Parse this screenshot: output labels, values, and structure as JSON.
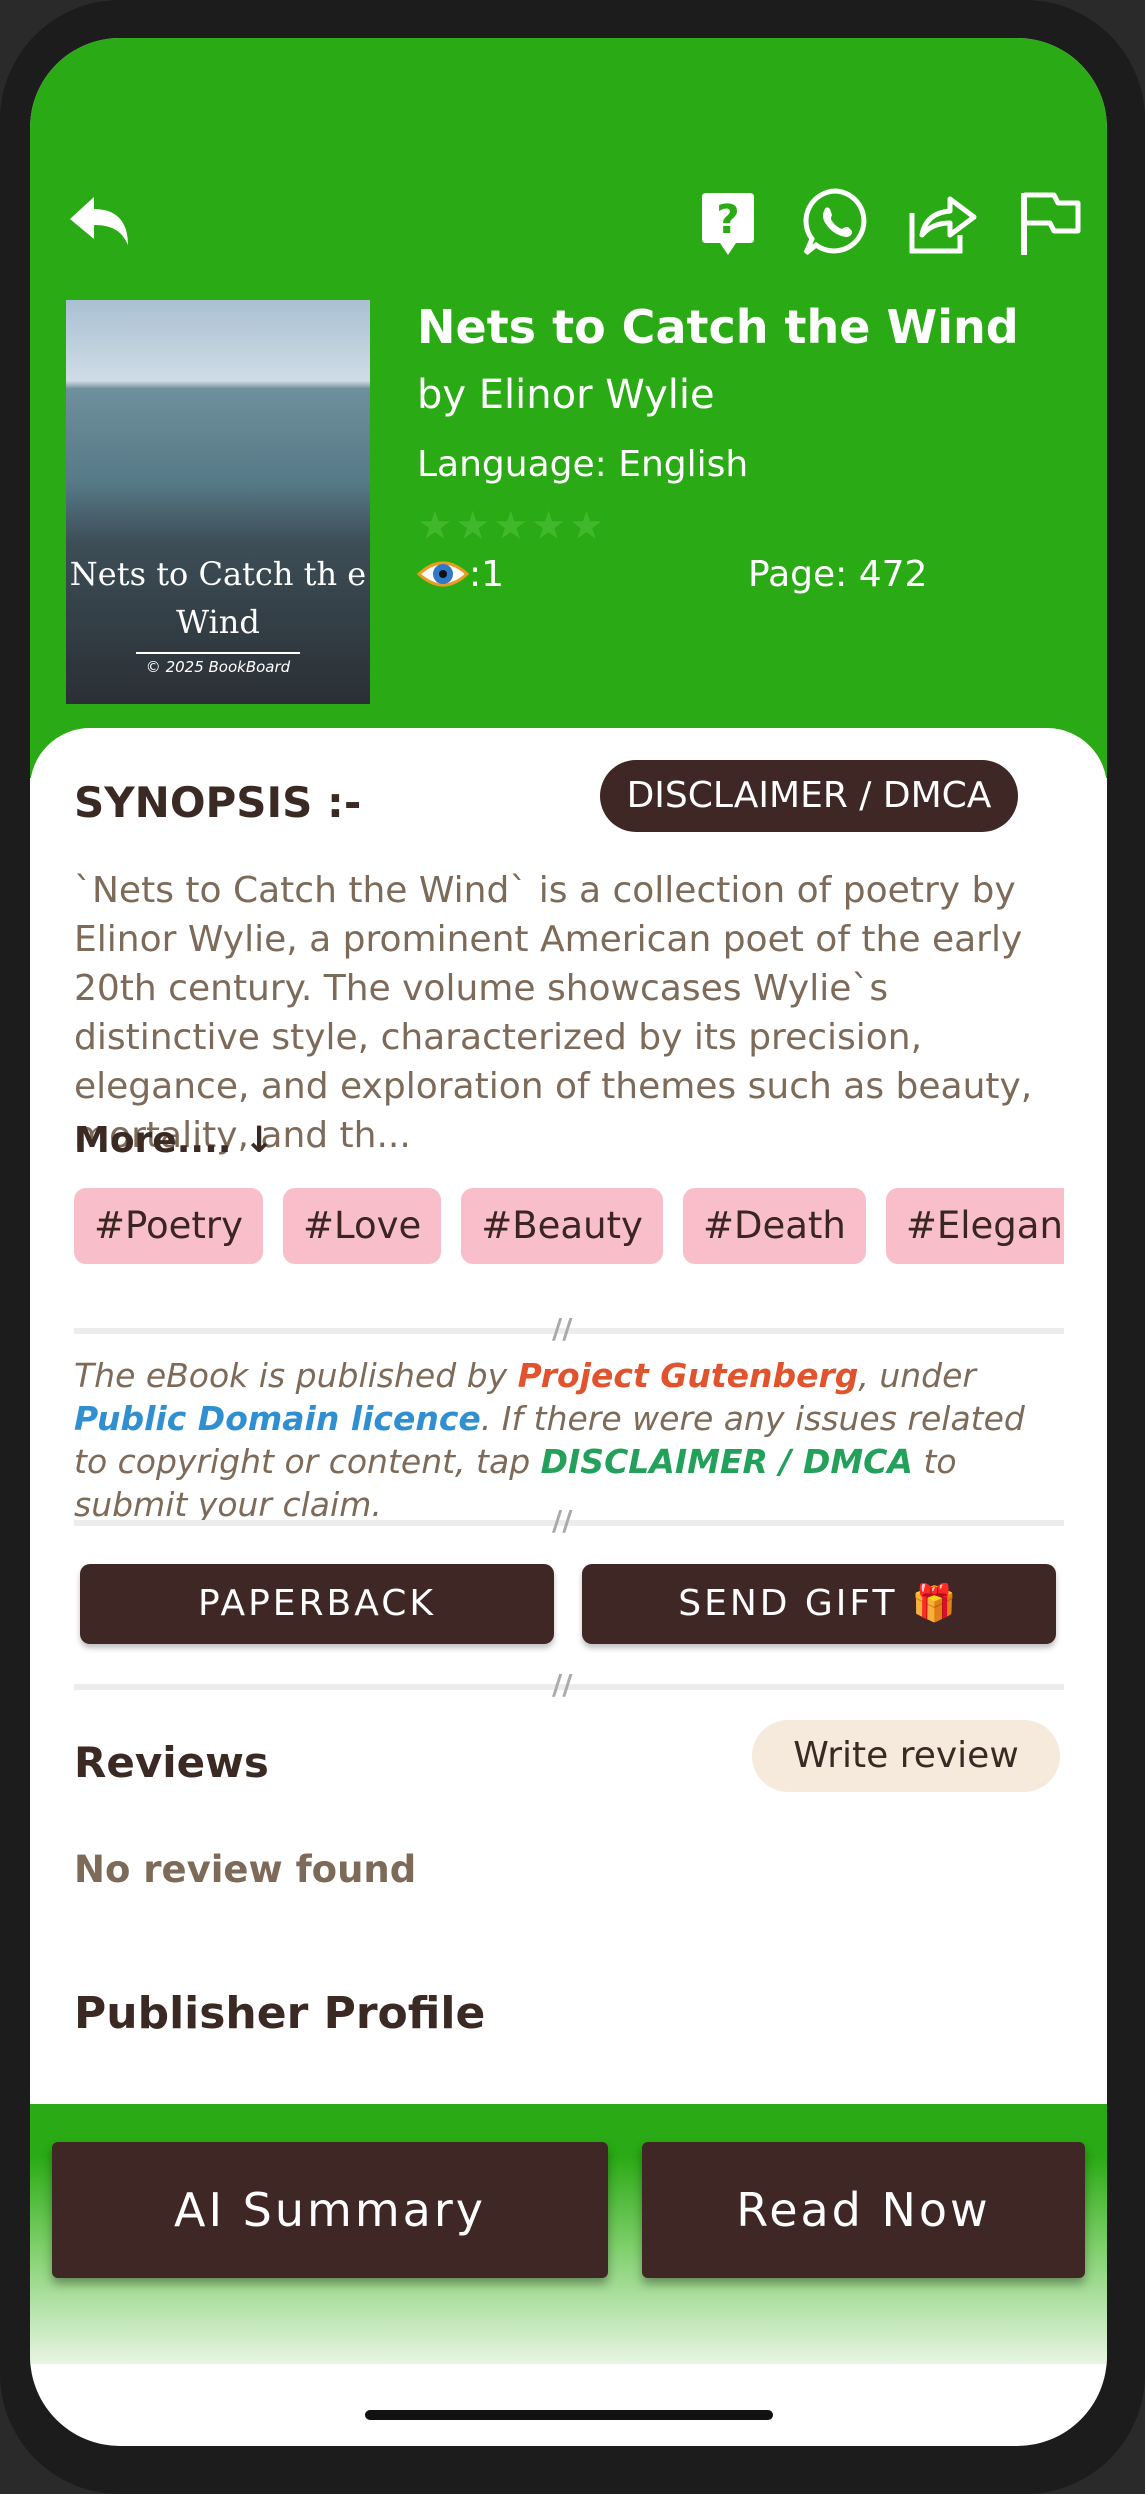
{
  "book": {
    "title": "Nets to Catch the Wind",
    "author": "by Elinor Wylie",
    "language": "Language: English",
    "rating_stars": "★★★★★",
    "views": ":1",
    "pages": "Page: 472",
    "cover_title": "Nets to Catch th e Wind",
    "cover_copyright": "© 2025 BookBoard"
  },
  "colors": {
    "header_green": "#2aaa14",
    "brown": "#3e2724",
    "tag_pink": "#f8bfcb"
  },
  "icons": [
    "back-arrow-icon",
    "help-icon",
    "whatsapp-icon",
    "share-icon",
    "flag-icon",
    "eye-icon",
    "gift-icon"
  ],
  "synopsis": {
    "heading": "SYNOPSIS :-",
    "dmca_button": "DISCLAIMER / DMCA",
    "text": "`Nets to Catch the Wind` is a collection of poetry by Elinor Wylie, a prominent American poet of the early 20th century. The volume showcases Wylie`s distinctive style, characterized by its precision, elegance, and exploration of themes such as beauty, mortality, and th...",
    "more": "More.... ↓"
  },
  "tags": [
    "#Poetry",
    "#Love",
    "#Beauty",
    "#Death",
    "#Elegance"
  ],
  "notice": {
    "part1": "The eBook is published by ",
    "gutenberg": "Project Gutenberg",
    "part2": ", under ",
    "licence": "Public Domain licence",
    "part3": ". If there were any issues related to copyright or content, tap ",
    "dmca": "DISCLAIMER / DMCA",
    "part4": " to submit your claim."
  },
  "actions": {
    "paperback": "PAPERBACK",
    "send_gift": "SEND GIFT 🎁"
  },
  "reviews": {
    "heading": "Reviews",
    "write_button": "Write review",
    "empty": "No review found"
  },
  "publisher": {
    "heading": "Publisher Profile"
  },
  "bottom": {
    "ai_summary": "AI Summary",
    "read_now": "Read Now"
  }
}
